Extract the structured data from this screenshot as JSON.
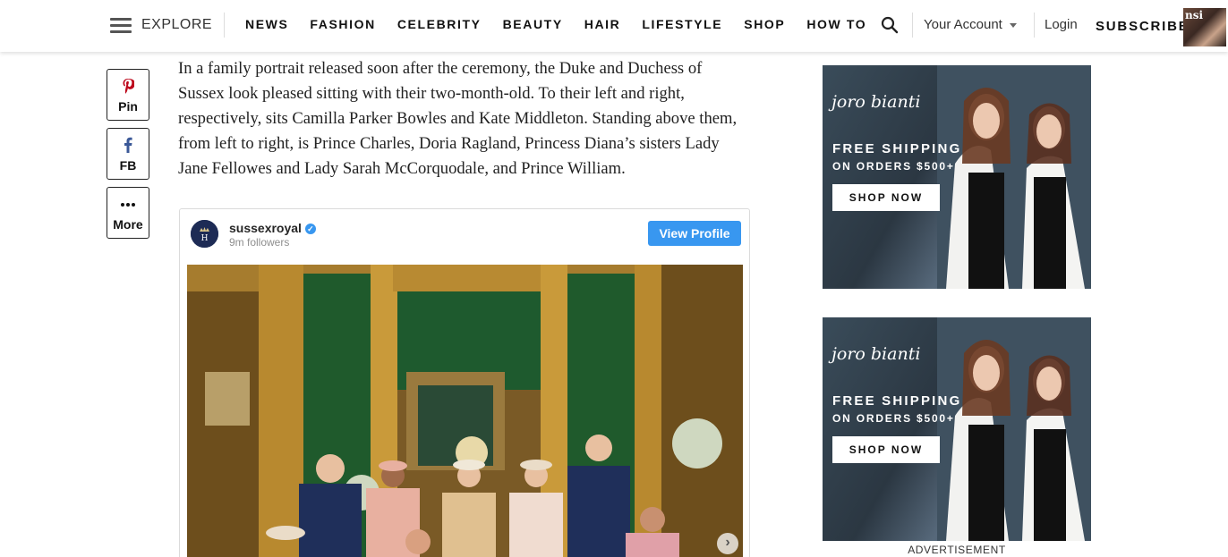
{
  "header": {
    "explore_label": "EXPLORE",
    "nav": [
      "NEWS",
      "FASHION",
      "CELEBRITY",
      "BEAUTY",
      "HAIR",
      "LIFESTYLE",
      "SHOP",
      "HOW TO"
    ],
    "account_label": "Your Account",
    "login_label": "Login",
    "subscribe_label": "SUBSCRIBE",
    "magazine_cover_text": "nsi"
  },
  "share": {
    "pin_label": "Pin",
    "fb_label": "FB",
    "more_label": "More"
  },
  "article": {
    "paragraph": "In a family portrait released soon after the ceremony, the Duke and Duchess of Sussex look pleased sitting with their two-month-old. To their left and right, respectively, sits Camilla Parker Bowles and Kate Middleton. Standing above them, from left to right, is Prince Charles, Doria Ragland, Princess Diana’s sisters Lady Jane Fellowes and Lady Sarah McCorquodale, and Prince William."
  },
  "instagram": {
    "username": "sussexroyal",
    "followers": "9m followers",
    "view_profile_label": "View Profile"
  },
  "ads": [
    {
      "brand": "joro bianti",
      "line1": "FREE SHIPPING",
      "line2": "ON ORDERS $500+",
      "cta": "SHOP NOW"
    },
    {
      "brand": "joro bianti",
      "line1": "FREE SHIPPING",
      "line2": "ON ORDERS $500+",
      "cta": "SHOP NOW"
    }
  ],
  "ad_label": "ADVERTISEMENT",
  "colors": {
    "pinterest": "#bd081c",
    "facebook": "#3b5998",
    "instagram_button": "#3897f0"
  }
}
